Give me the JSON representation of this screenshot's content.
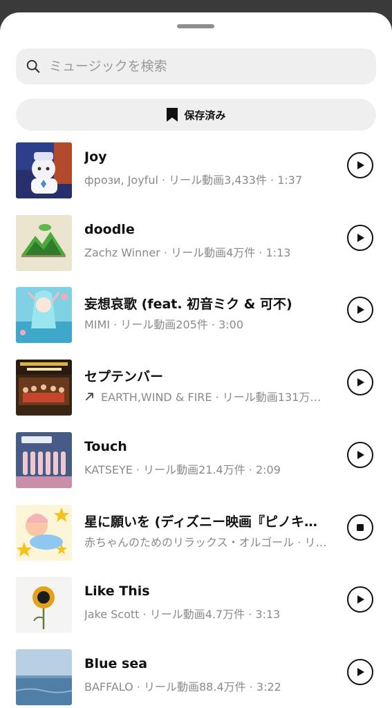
{
  "search": {
    "placeholder": "ミュージックを検索"
  },
  "saved_button": {
    "label": "保存済み"
  },
  "tracks": [
    {
      "title": "Joy",
      "meta": "фрози, Joyful · リール動画3,433件 · 1:37",
      "state": "play"
    },
    {
      "title": "doodle",
      "meta": "Zachz Winner · リール動画4万件 · 1:13",
      "state": "play"
    },
    {
      "title": "妄想哀歌 (feat. 初音ミク & 可不)",
      "meta": "MIMI · リール動画205件 · 3:00",
      "state": "play"
    },
    {
      "title": "セプテンバー",
      "meta": "EARTH,WIND & FIRE · リール動画131万…",
      "state": "play",
      "trending": true
    },
    {
      "title": "Touch",
      "meta": "KATSEYE · リール動画21.4万件 · 2:09",
      "state": "play"
    },
    {
      "title": "星に願いを (ディズニー映画『ピノキ…",
      "meta": "赤ちゃんのためのリラックス・オルゴール · リ…",
      "state": "stop"
    },
    {
      "title": "Like This",
      "meta": "Jake Scott · リール動画4.7万件 · 3:13",
      "state": "play"
    },
    {
      "title": "Blue sea",
      "meta": "BAFFALO · リール動画88.4万件 · 3:22",
      "state": "play"
    }
  ],
  "icons": {
    "search": "search-icon",
    "bookmark": "bookmark-icon",
    "play": "play-icon",
    "stop": "stop-icon",
    "trending": "trending-arrow-icon"
  }
}
